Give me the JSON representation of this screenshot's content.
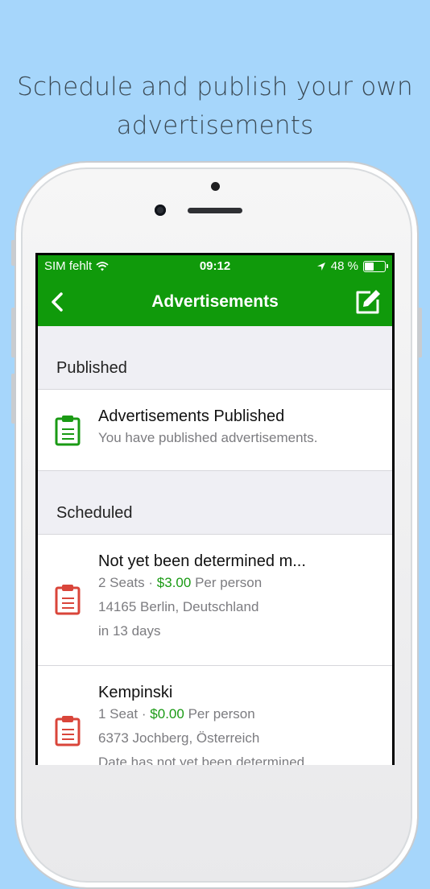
{
  "headline": {
    "line1": "Schedule and publish your own",
    "line2": "advertisements"
  },
  "status_bar": {
    "carrier": "SIM fehlt",
    "time": "09:12",
    "battery_percent": "48 %",
    "battery_level": 0.48
  },
  "nav": {
    "title": "Advertisements"
  },
  "sections": {
    "published": {
      "header": "Published",
      "item": {
        "title": "Advertisements Published",
        "subtitle": "You have published advertisements."
      }
    },
    "scheduled": {
      "header": "Scheduled",
      "items": [
        {
          "title": "Not yet been determined m...",
          "seats": "2 Seats ·",
          "price": "$3.00",
          "per": "Per person",
          "location": "14165 Berlin, Deutschland",
          "when": "in 13 days"
        },
        {
          "title": "Kempinski",
          "seats": "1 Seat ·",
          "price": "$0.00",
          "per": "Per person",
          "location": "6373 Jochberg, Österreich",
          "when": "Date has not yet been determined"
        }
      ]
    }
  },
  "colors": {
    "background": "#a6d6fb",
    "navbar": "#109a0b",
    "published_icon": "#1a9a14",
    "scheduled_icon": "#d9453a",
    "price": "#1a9a14"
  },
  "icons": {
    "back": "chevron-left-icon",
    "compose": "compose-icon",
    "published": "clipboard-icon",
    "scheduled": "clipboard-icon",
    "wifi": "wifi-icon",
    "location": "location-arrow-icon",
    "battery": "battery-icon"
  }
}
